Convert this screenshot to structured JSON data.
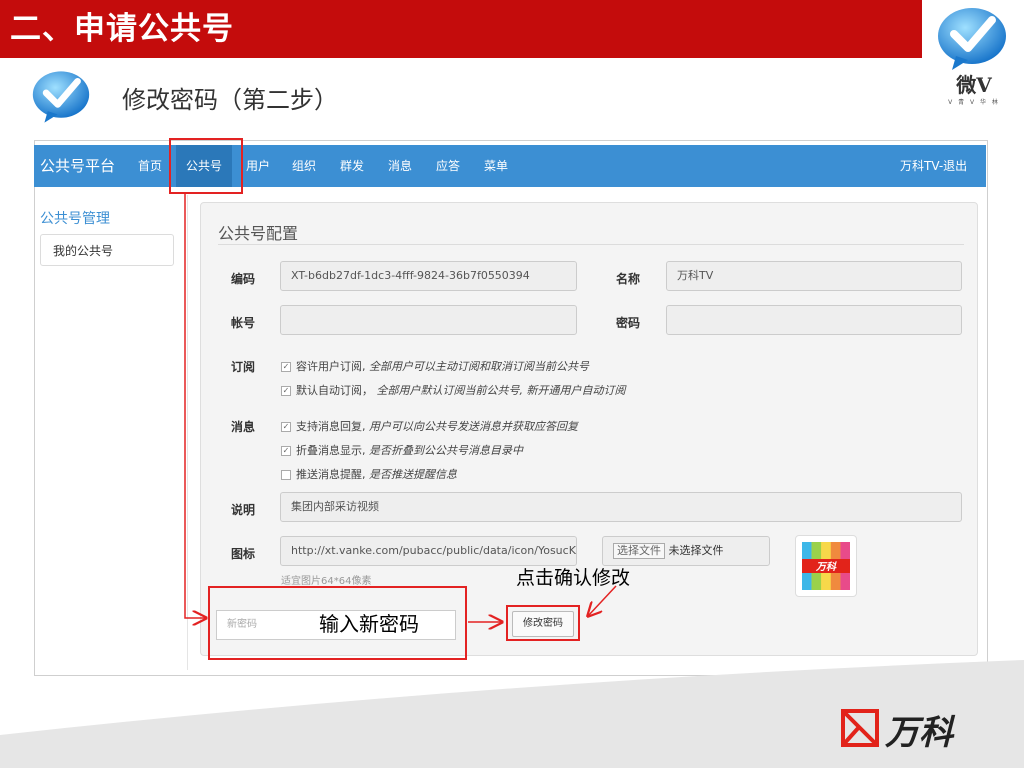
{
  "slide": {
    "title": "二、申请公共号",
    "step_title": "修改密码（第二步）",
    "logo_text": "微V",
    "logo_sub": "V 青 V 华 林",
    "footer_brand": "万科"
  },
  "nav": {
    "brand": "公共号平台",
    "items": [
      "首页",
      "公共号",
      "用户",
      "组织",
      "群发",
      "消息",
      "应答",
      "菜单"
    ],
    "active_index": 1,
    "user_logout": "万科TV-退出"
  },
  "sidebar": {
    "title": "公共号管理",
    "items": [
      "我的公共号"
    ]
  },
  "panel": {
    "title": "公共号配置",
    "code_label": "编码",
    "code_value": "XT-b6db27df-1dc3-4fff-9824-36b7f0550394",
    "name_label": "名称",
    "name_value": "万科TV",
    "account_label": "帐号",
    "account_value": "",
    "password_label": "密码",
    "password_value": "",
    "subscribe_label": "订阅",
    "subscribe_options": [
      {
        "checked": true,
        "label": "容许用户订阅,",
        "note": "全部用户可以主动订阅和取消订阅当前公共号"
      },
      {
        "checked": true,
        "label": "默认自动订阅，",
        "note": "全部用户默认订阅当前公共号, 新开通用户自动订阅"
      }
    ],
    "message_label": "消息",
    "message_options": [
      {
        "checked": true,
        "label": "支持消息回复,",
        "note": "用户可以向公共号发送消息并获取应答回复"
      },
      {
        "checked": true,
        "label": "折叠消息显示,",
        "note": "是否折叠到公公共号消息目录中"
      },
      {
        "checked": false,
        "label": "推送消息提醒,",
        "note": "是否推送提醒信息"
      }
    ],
    "desc_label": "说明",
    "desc_value": "集团内部采访视频",
    "icon_label": "图标",
    "icon_url": "http://xt.vanke.com/pubacc/public/data/icon/YosucKX(",
    "file_button": "选择文件",
    "file_status": "未选择文件",
    "icon_hint": "适宜图片64*64像素",
    "thumb_text": "万科",
    "new_password_placeholder": "新密码",
    "change_password_button": "修改密码"
  },
  "annotations": {
    "input_new_password": "输入新密码",
    "click_confirm": "点击确认修改"
  }
}
